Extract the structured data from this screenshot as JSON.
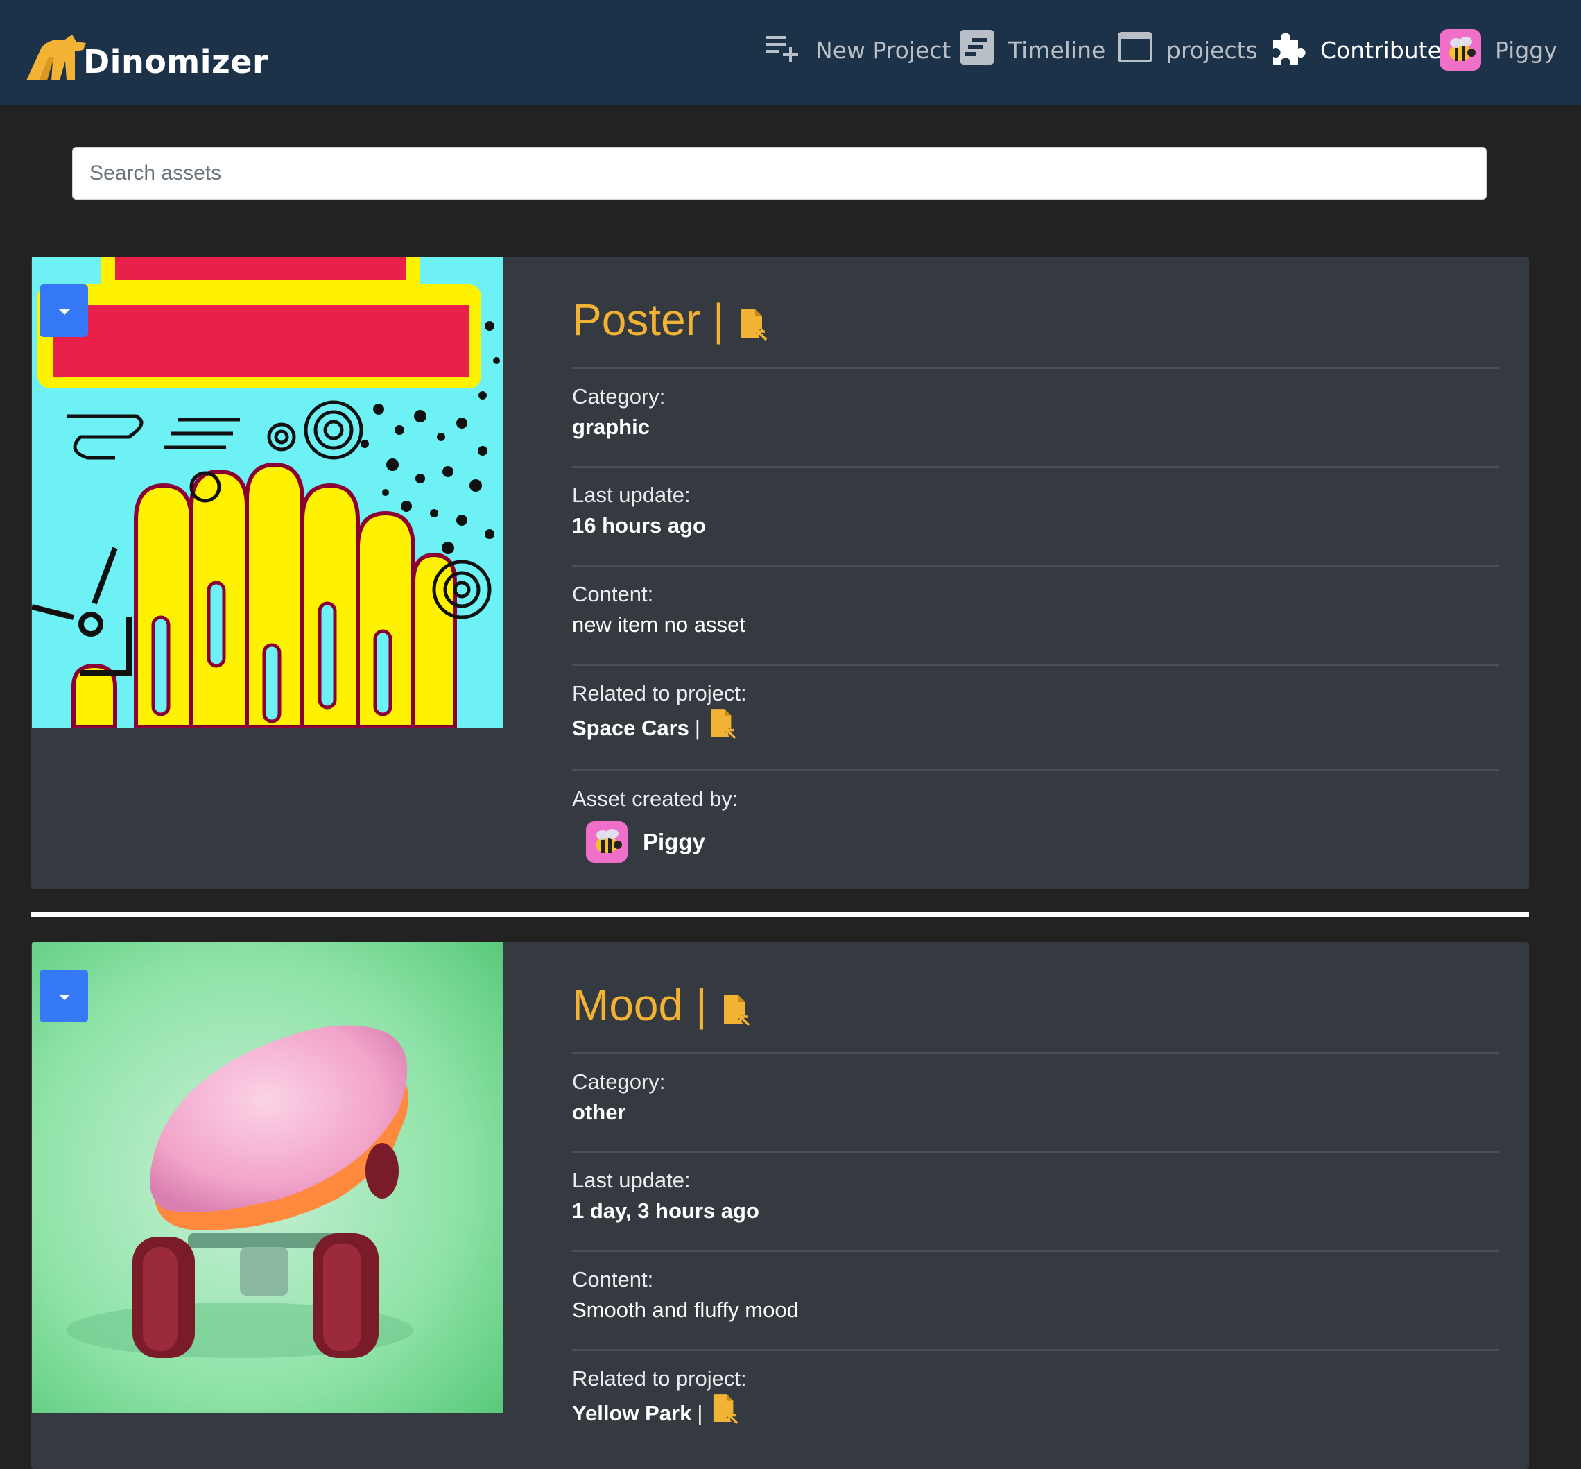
{
  "brand": {
    "name": "Dinomizer",
    "accent": "#f2b233"
  },
  "nav": {
    "new_project": {
      "label": "New Project",
      "icon": "playlist-add-icon"
    },
    "timeline": {
      "label": "Timeline",
      "icon": "timeline-icon"
    },
    "projects": {
      "label": "projects",
      "icon": "window-icon"
    },
    "contribute": {
      "label": "Contribute",
      "icon": "puzzle-icon"
    },
    "user": {
      "name": "Piggy",
      "avatar": "bee-avatar"
    }
  },
  "search": {
    "placeholder": "Search assets",
    "value": ""
  },
  "assets": [
    {
      "title": "Poster",
      "separator": "|",
      "image": "poster-artwork",
      "category_label": "Category:",
      "category": "graphic",
      "updated_label": "Last update:",
      "updated": "16 hours ago",
      "content_label": "Content:",
      "content": "new item no asset",
      "project_label": "Related to project:",
      "project": "Space Cars",
      "project_separator": "|",
      "creator_label": "Asset created by:",
      "creator": "Piggy"
    },
    {
      "title": "Mood",
      "separator": "|",
      "image": "fluffy-skateboard-photo",
      "category_label": "Category:",
      "category": "other",
      "updated_label": "Last update:",
      "updated": "1 day, 3 hours ago",
      "content_label": "Content:",
      "content": "Smooth and fluffy mood",
      "project_label": "Related to project:",
      "project": "Yellow Park",
      "project_separator": "|"
    }
  ],
  "colors": {
    "navbar": "#1c3248",
    "page_bg": "#222222",
    "card_bg": "#343a40",
    "title": "#f2b233",
    "dropdown": "#3579f6",
    "avatar_bg": "#f06fc8"
  }
}
